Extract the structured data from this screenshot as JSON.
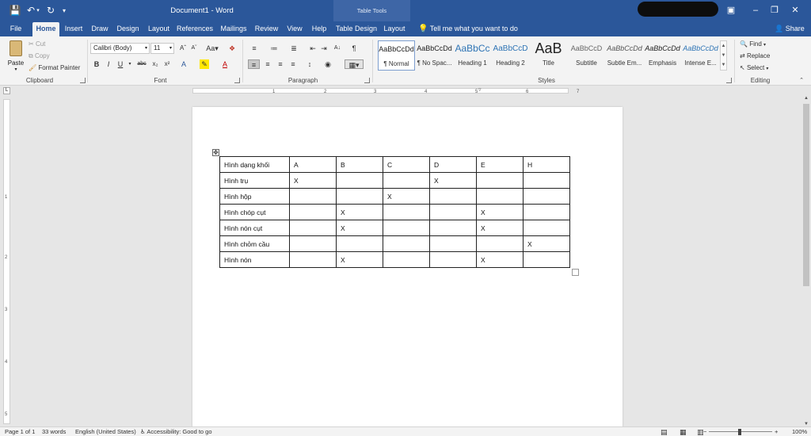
{
  "window": {
    "title": "Document1  -  Word",
    "contextual_tab_group": "Table Tools",
    "qat": {
      "save_icon": "save-icon",
      "undo_icon": "undo-icon",
      "redo_icon": "redo-icon"
    }
  },
  "tabs": [
    {
      "label": "File"
    },
    {
      "label": "Home"
    },
    {
      "label": "Insert"
    },
    {
      "label": "Draw"
    },
    {
      "label": "Design"
    },
    {
      "label": "Layout"
    },
    {
      "label": "References"
    },
    {
      "label": "Mailings"
    },
    {
      "label": "Review"
    },
    {
      "label": "View"
    },
    {
      "label": "Help"
    },
    {
      "label": "Table Design"
    },
    {
      "label": "Layout"
    }
  ],
  "tell_me": "Tell me what you want to do",
  "share": "Share",
  "clipboard": {
    "paste": "Paste",
    "cut": "Cut",
    "copy": "Copy",
    "format_painter": "Format Painter",
    "group": "Clipboard"
  },
  "font": {
    "name": "Calibri (Body)",
    "size": "11",
    "group": "Font"
  },
  "paragraph": {
    "group": "Paragraph"
  },
  "styles": {
    "group": "Styles",
    "items": [
      {
        "sample": "AaBbCcDd",
        "name": "¶ Normal"
      },
      {
        "sample": "AaBbCcDd",
        "name": "¶ No Spac..."
      },
      {
        "sample": "AaBbCc",
        "name": "Heading 1"
      },
      {
        "sample": "AaBbCcD",
        "name": "Heading 2"
      },
      {
        "sample": "AaB",
        "name": "Title"
      },
      {
        "sample": "AaBbCcD",
        "name": "Subtitle"
      },
      {
        "sample": "AaBbCcDd",
        "name": "Subtle Em..."
      },
      {
        "sample": "AaBbCcDd",
        "name": "Emphasis"
      },
      {
        "sample": "AaBbCcDd",
        "name": "Intense E..."
      }
    ]
  },
  "editing": {
    "find": "Find",
    "replace": "Replace",
    "select": "Select",
    "group": "Editing"
  },
  "ruler": {
    "h_numbers": [
      "1",
      "2",
      "3",
      "4",
      "5",
      "6",
      "7"
    ],
    "v_numbers": [
      "1",
      "2",
      "3",
      "4",
      "5"
    ]
  },
  "table": {
    "rows": [
      [
        "Hình dạng khối",
        "A",
        "B",
        "C",
        "D",
        "E",
        "H"
      ],
      [
        "Hình trụ",
        "X",
        "",
        "",
        "X",
        "",
        ""
      ],
      [
        "Hình hộp",
        "",
        "",
        "X",
        "",
        "",
        ""
      ],
      [
        "Hình chóp cụt",
        "",
        "X",
        "",
        "",
        "X",
        ""
      ],
      [
        "Hình nón cụt",
        "",
        "X",
        "",
        "",
        "X",
        ""
      ],
      [
        "Hình chỏm cầu",
        "",
        "",
        "",
        "",
        "",
        "X"
      ],
      [
        "Hình nón",
        "",
        "X",
        "",
        "",
        "X",
        ""
      ]
    ]
  },
  "status": {
    "page": "Page 1 of 1",
    "words": "33 words",
    "language": "English (United States)",
    "accessibility": "Accessibility: Good to go",
    "zoom": "100%"
  }
}
